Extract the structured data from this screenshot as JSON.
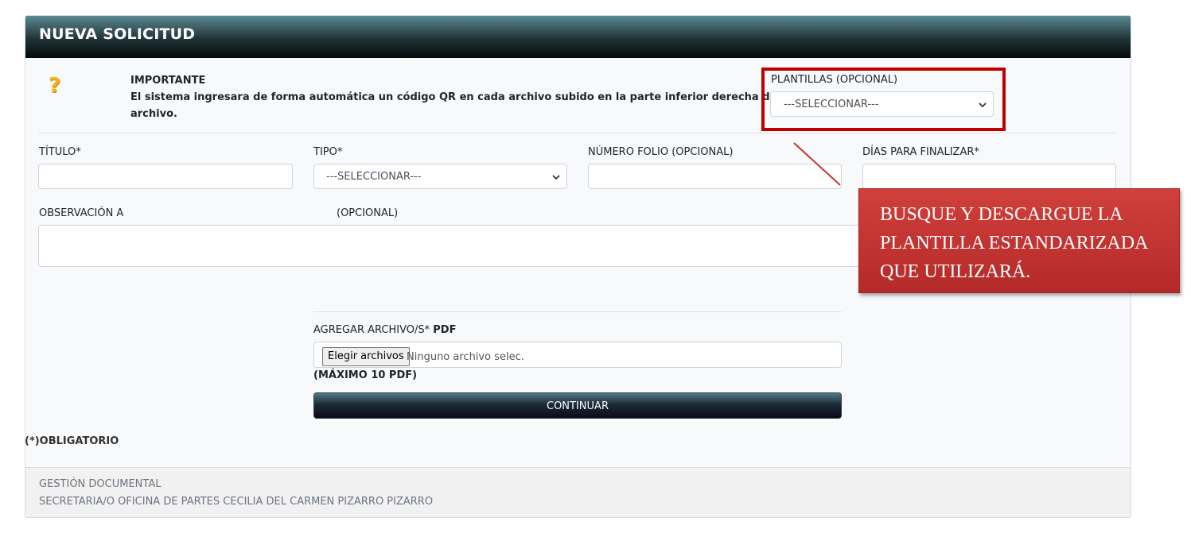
{
  "header": {
    "title": "NUEVA SOLICITUD"
  },
  "notice": {
    "icon": "question-mark-icon",
    "title": "IMPORTANTE",
    "text_line1": "El sistema ingresara de forma automática un código QR en cada archivo subido en la parte inferior derecha de dicho",
    "text_line2": "archivo."
  },
  "plantillas": {
    "label": "PLANTILLAS (OPCIONAL)",
    "selected": "---SELECCIONAR---"
  },
  "fields": {
    "titulo_label": "TÍTULO*",
    "tipo_label": "TIPO*",
    "tipo_selected": "---SELECCIONAR---",
    "folio_label": "NÚMERO FOLIO (OPCIONAL)",
    "dias_label": "DÍAS PARA FINALIZAR*",
    "observacion_label": "OBSERVACIÓN A",
    "observacion_suffix": "(OPCIONAL)"
  },
  "upload": {
    "label": "AGREGAR ARCHIVO/S*",
    "label_bold": "PDF",
    "button": "Elegir archivos",
    "status": "Ninguno archivo selec.",
    "max": "(MÁXIMO 10 PDF)"
  },
  "continue_button": "CONTINUAR",
  "required_note": "(*)OBLIGATORIO",
  "footer": {
    "line1": "GESTIÓN DOCUMENTAL",
    "line2": "SECRETARIA/O OFICINA DE PARTES CECILIA DEL CARMEN PIZARRO PIZARRO"
  },
  "callout": {
    "text": "BUSQUE Y DESCARGUE LA PLANTILLA ESTANDARIZADA QUE UTILIZARÁ."
  },
  "colors": {
    "annotation_red": "#c00000",
    "callout_red": "#c23532",
    "header_dark": "#0a1214"
  }
}
